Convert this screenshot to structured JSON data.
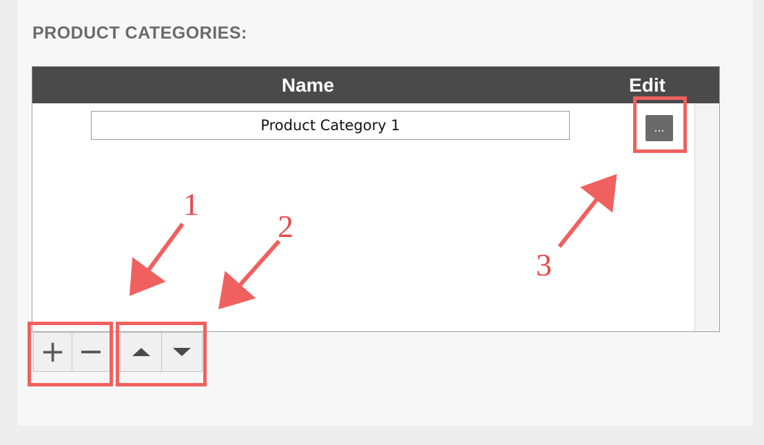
{
  "section": {
    "title": "PRODUCT CATEGORIES:"
  },
  "table": {
    "columns": {
      "name": "Name",
      "edit": "Edit"
    },
    "rows": [
      {
        "name": "Product Category 1",
        "edit_label": "..."
      }
    ]
  },
  "toolbar": {
    "add_icon": "plus-icon",
    "remove_icon": "minus-icon",
    "move_up_icon": "triangle-up-icon",
    "move_down_icon": "triangle-down-icon"
  },
  "annotations": {
    "labels": [
      "1",
      "2",
      "3"
    ],
    "color": "#f0605e"
  },
  "colors": {
    "header_bg": "#4a4a4a",
    "header_text": "#ffffff",
    "title_text": "#6a6a6a",
    "edit_button_bg": "#6a6a6a"
  }
}
